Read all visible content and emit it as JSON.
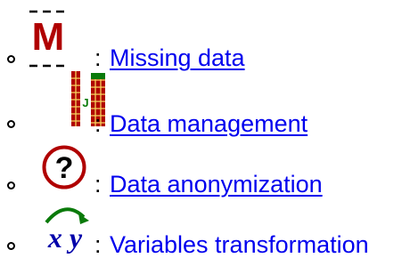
{
  "items": [
    {
      "icon": "missing-data-icon",
      "separator": ":",
      "label": "Missing data",
      "underlined": true
    },
    {
      "icon": "data-management-icon",
      "separator": ":",
      "label": "Data management",
      "underlined": true
    },
    {
      "icon": "data-anonymization-icon",
      "separator": ":",
      "label": "Data anonymization",
      "underlined": true
    },
    {
      "icon": "variables-transformation-icon",
      "separator": ":",
      "label": "Variables transformation",
      "underlined": false
    }
  ],
  "colors": {
    "link": "#0000ee",
    "icon_red": "#b00000",
    "icon_green": "#0a7a0a",
    "text": "#000000"
  }
}
